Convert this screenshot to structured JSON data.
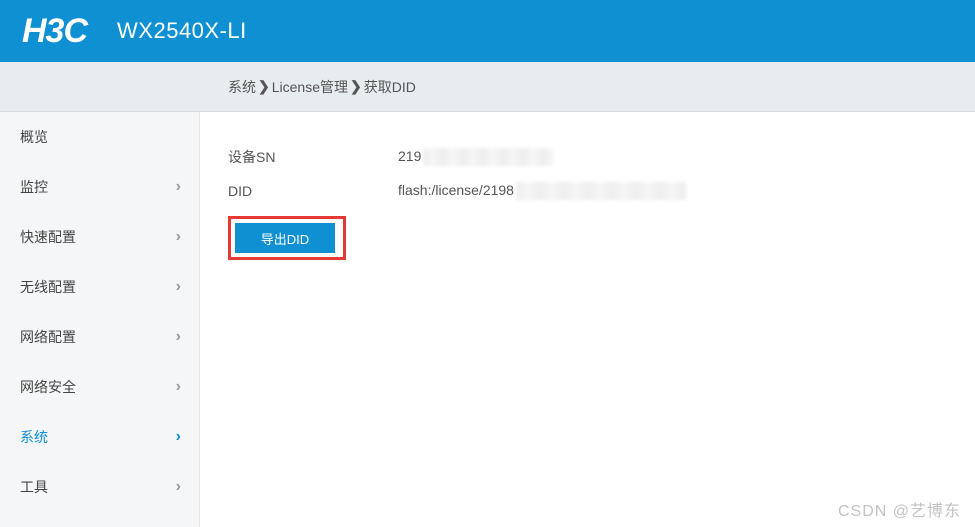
{
  "header": {
    "logo": "H3C",
    "model": "WX2540X-LI"
  },
  "breadcrumb": {
    "items": [
      "系统",
      "License管理",
      "获取DID"
    ]
  },
  "sidebar": {
    "items": [
      {
        "label": "概览",
        "hasChevron": false,
        "active": false
      },
      {
        "label": "监控",
        "hasChevron": true,
        "active": false
      },
      {
        "label": "快速配置",
        "hasChevron": true,
        "active": false
      },
      {
        "label": "无线配置",
        "hasChevron": true,
        "active": false
      },
      {
        "label": "网络配置",
        "hasChevron": true,
        "active": false
      },
      {
        "label": "网络安全",
        "hasChevron": true,
        "active": false
      },
      {
        "label": "系统",
        "hasChevron": true,
        "active": true
      },
      {
        "label": "工具",
        "hasChevron": true,
        "active": false
      }
    ]
  },
  "content": {
    "sn_label": "设备SN",
    "sn_prefix": "219",
    "did_label": "DID",
    "did_prefix": "flash:/license/2198",
    "export_btn": "导出DID"
  },
  "watermark": "CSDN @艺博东"
}
